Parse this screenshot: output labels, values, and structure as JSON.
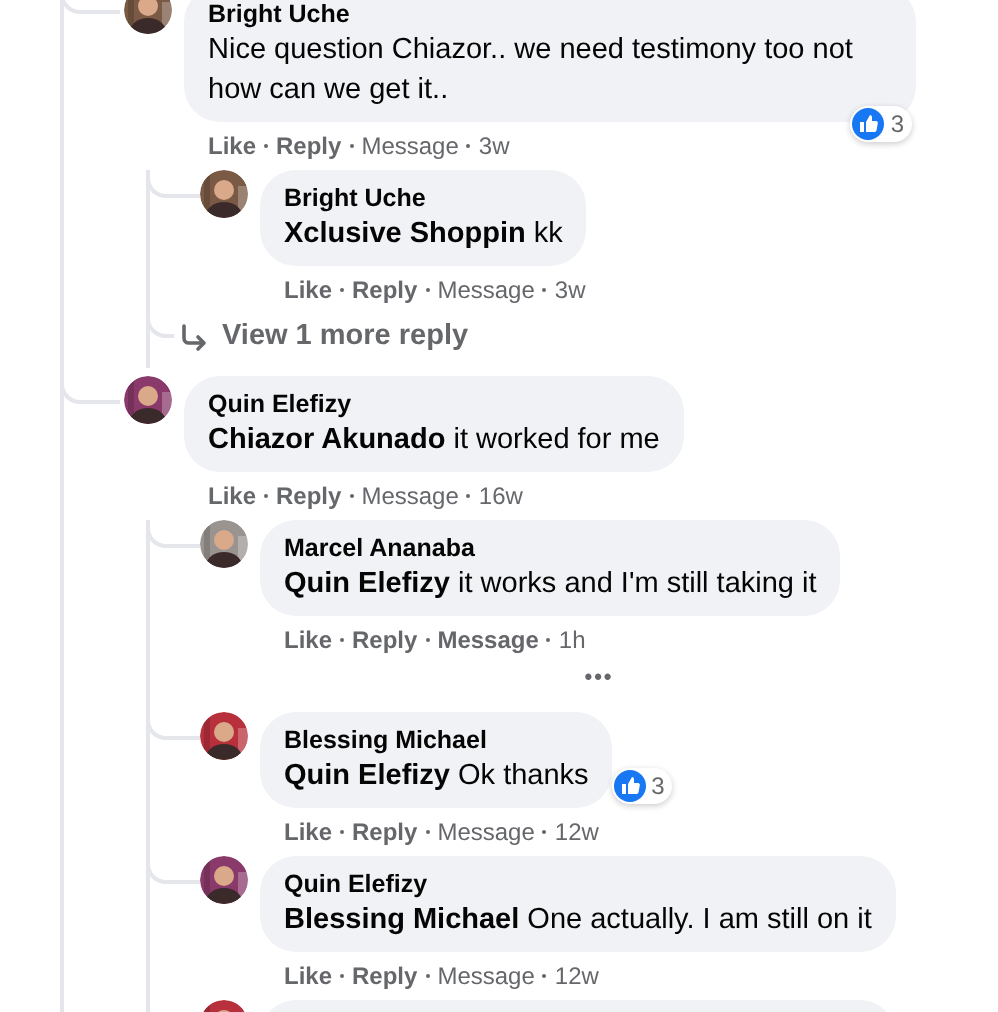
{
  "comments": [
    {
      "author": "Bright Uche",
      "text": "Nice question Chiazor.. we need testimony too not how can we get it..",
      "avatar": {
        "kind": "picture",
        "color": "#7a5a44"
      },
      "reaction": {
        "count": "3"
      },
      "actions": [
        {
          "label": "Like",
          "bold": true
        },
        {
          "label": "Reply",
          "bold": true
        },
        {
          "label": "Message",
          "bold": false
        }
      ],
      "time": "3w",
      "replies": [
        {
          "author": "Bright Uche",
          "text": "**Xclusive Shoppin** kk",
          "avatar": {
            "kind": "picture",
            "color": "#7a5a44"
          },
          "actions": [
            {
              "label": "Like",
              "bold": true
            },
            {
              "label": "Reply",
              "bold": true
            },
            {
              "label": "Message",
              "bold": false
            }
          ],
          "time": "3w"
        }
      ],
      "view_more": "View 1 more reply"
    },
    {
      "author": "Quin Elefizy",
      "text": "**Chiazor Akunado** it worked for me",
      "avatar": {
        "kind": "picture",
        "color": "#8a3a6a"
      },
      "actions": [
        {
          "label": "Like",
          "bold": true
        },
        {
          "label": "Reply",
          "bold": true
        },
        {
          "label": "Message",
          "bold": false
        }
      ],
      "time": "16w",
      "replies": [
        {
          "author": "Marcel Ananaba",
          "text": "**Quin Elefizy** it works and I'm still taking it",
          "avatar": {
            "kind": "picture",
            "color": "#9a9490"
          },
          "actions": [
            {
              "label": "Like",
              "bold": true
            },
            {
              "label": "Reply",
              "bold": true
            },
            {
              "label": "Message",
              "bold": true
            }
          ],
          "time": "1h"
        },
        {
          "kind": "more",
          "label": "•••"
        },
        {
          "author": "Blessing Michael",
          "text": "**Quin Elefizy** Ok thanks",
          "avatar": {
            "kind": "picture",
            "color": "#b8303c"
          },
          "reaction": {
            "count": "3"
          },
          "actions": [
            {
              "label": "Like",
              "bold": true
            },
            {
              "label": "Reply",
              "bold": true
            },
            {
              "label": "Message",
              "bold": false
            }
          ],
          "time": "12w"
        },
        {
          "author": "Quin Elefizy",
          "text": "**Blessing Michael** One actually. I am still on it",
          "avatar": {
            "kind": "picture",
            "color": "#8a3a6a"
          },
          "actions": [
            {
              "label": "Like",
              "bold": true
            },
            {
              "label": "Reply",
              "bold": true
            },
            {
              "label": "Message",
              "bold": false
            }
          ],
          "time": "12w"
        },
        {
          "kind": "partial",
          "avatar": {
            "kind": "picture",
            "color": "#b8303c"
          }
        }
      ]
    }
  ]
}
